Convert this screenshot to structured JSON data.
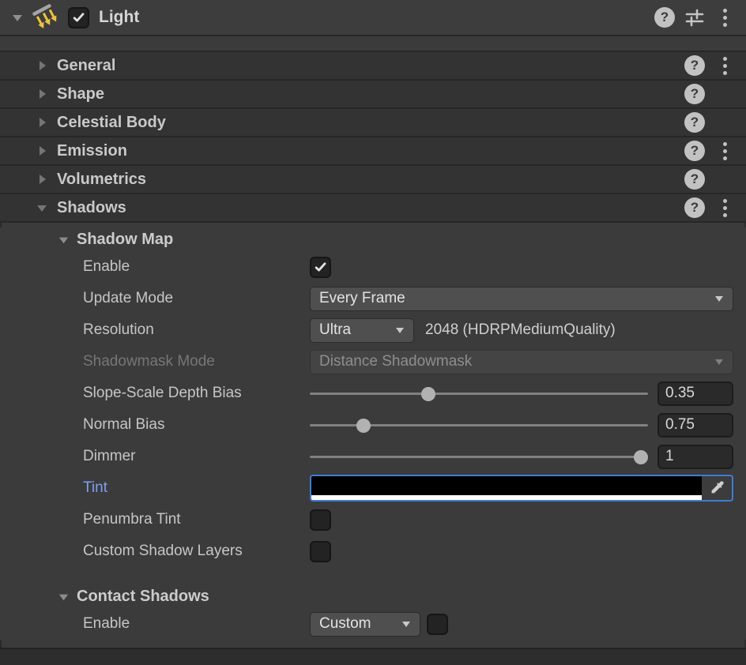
{
  "window": {
    "app": "Unity Inspector",
    "component": "Light"
  },
  "header": {
    "title": "Light",
    "enabled": true,
    "icons": {
      "help": "help-circle",
      "presets": "presets-sliders",
      "menu": "kebab-menu"
    }
  },
  "sections": [
    {
      "label": "General",
      "expanded": false,
      "has_help": true,
      "has_menu": true
    },
    {
      "label": "Shape",
      "expanded": false,
      "has_help": true,
      "has_menu": false
    },
    {
      "label": "Celestial Body",
      "expanded": false,
      "has_help": true,
      "has_menu": false
    },
    {
      "label": "Emission",
      "expanded": false,
      "has_help": true,
      "has_menu": true
    },
    {
      "label": "Volumetrics",
      "expanded": false,
      "has_help": true,
      "has_menu": false
    },
    {
      "label": "Shadows",
      "expanded": true,
      "has_help": true,
      "has_menu": true
    }
  ],
  "shadow_map": {
    "title": "Shadow Map",
    "enable": {
      "label": "Enable",
      "checked": true
    },
    "update_mode": {
      "label": "Update Mode",
      "value": "Every Frame"
    },
    "resolution": {
      "label": "Resolution",
      "value": "Ultra",
      "detail": "2048 (HDRPMediumQuality)"
    },
    "shadowmask_mode": {
      "label": "Shadowmask Mode",
      "value": "Distance Shadowmask",
      "disabled": true
    },
    "slope_bias": {
      "label": "Slope-Scale Depth Bias",
      "value": "0.35",
      "slider_pct": 35
    },
    "normal_bias": {
      "label": "Normal Bias",
      "value": "0.75",
      "slider_pct": 16
    },
    "dimmer": {
      "label": "Dimmer",
      "value": "1",
      "slider_pct": 98
    },
    "tint": {
      "label": "Tint",
      "rgb": "#000000",
      "alpha_bar": "#FFFFFF",
      "focused": true
    },
    "penumbra_tint": {
      "label": "Penumbra Tint",
      "checked": false
    },
    "custom_shadow_layers": {
      "label": "Custom Shadow Layers",
      "checked": false
    }
  },
  "contact_shadows": {
    "title": "Contact Shadows",
    "enable": {
      "label": "Enable",
      "value": "Custom",
      "checked": false
    }
  },
  "colors": {
    "accent_label": "#7F9FF0",
    "focus_border": "#3E7CD6",
    "section_bg": "#333333",
    "body_bg": "#3B3B3B",
    "light_icon_yellow": "#EFC23F"
  }
}
